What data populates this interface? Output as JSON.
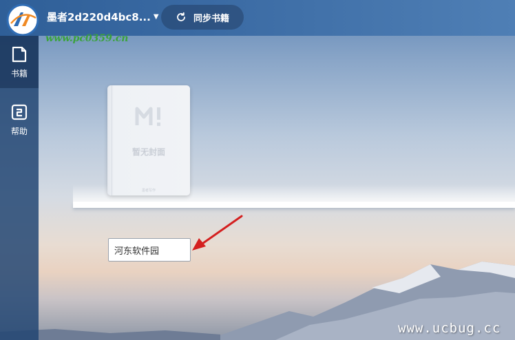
{
  "header": {
    "user_name": "墨者2d220d4bc8...",
    "sync_button_label": "同步书籍"
  },
  "sidebar": {
    "items": [
      {
        "label": "书籍",
        "icon": "book-icon",
        "active": true
      },
      {
        "label": "帮助",
        "icon": "help-icon",
        "active": false
      }
    ]
  },
  "shelf": {
    "books": [
      {
        "cover_text": "暂无封面",
        "publisher": "墨者写作"
      }
    ]
  },
  "rename_input": {
    "value": "河东软件园"
  },
  "watermarks": {
    "site_url": "www.pc0359.cn",
    "bottom_url": "www.ucbug.cc"
  },
  "colors": {
    "topbar": "#2f5f98",
    "sidebar": "#234673",
    "arrow": "#d42020",
    "watermark_green": "#3aa33a"
  }
}
